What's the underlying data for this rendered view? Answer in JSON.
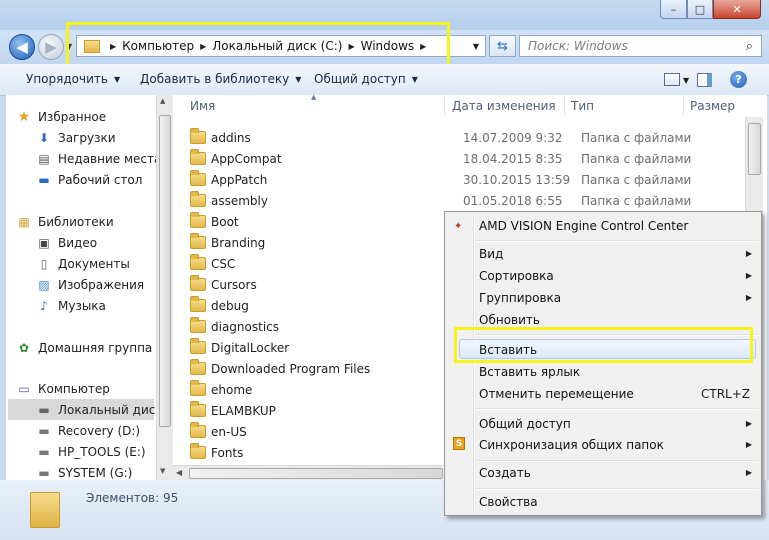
{
  "window": {
    "minimize_label": "–",
    "maximize_label": "□",
    "close_label": "✕"
  },
  "nav": {
    "back_icon": "back-arrow-icon",
    "forward_icon": "forward-arrow-icon"
  },
  "address": {
    "crumbs": [
      "Компьютер",
      "Локальный диск (C:)",
      "Windows"
    ],
    "highlight_color": "#f6f21a"
  },
  "search": {
    "placeholder": "Поиск: Windows"
  },
  "toolbar": {
    "organize": "Упорядочить",
    "add_to_library": "Добавить в библиотеку",
    "share": "Общий доступ"
  },
  "sidebar": {
    "favorites": "Избранное",
    "downloads": "Загрузки",
    "recent": "Недавние места",
    "desktop": "Рабочий стол",
    "libraries": "Библиотеки",
    "video": "Видео",
    "documents": "Документы",
    "images": "Изображения",
    "music": "Музыка",
    "homegroup": "Домашняя группа",
    "computer": "Компьютер",
    "local_disk": "Локальный диск",
    "recovery": "Recovery (D:)",
    "hp_tools": "HP_TOOLS (E:)",
    "system": "SYSTEM (G:)"
  },
  "columns": {
    "name": "Имя",
    "date": "Дата изменения",
    "type": "Тип",
    "size": "Размер"
  },
  "files": [
    {
      "name": "addins",
      "date": "14.07.2009 9:32",
      "type": "Папка с файлами"
    },
    {
      "name": "AppCompat",
      "date": "18.04.2015 8:35",
      "type": "Папка с файлами"
    },
    {
      "name": "AppPatch",
      "date": "30.10.2015 13:59",
      "type": "Папка с файлами"
    },
    {
      "name": "assembly",
      "date": "01.05.2018 6:55",
      "type": "Папка с файлами"
    },
    {
      "name": "Boot",
      "date": "",
      "type": ""
    },
    {
      "name": "Branding",
      "date": "",
      "type": ""
    },
    {
      "name": "CSC",
      "date": "",
      "type": ""
    },
    {
      "name": "Cursors",
      "date": "",
      "type": ""
    },
    {
      "name": "debug",
      "date": "",
      "type": ""
    },
    {
      "name": "diagnostics",
      "date": "",
      "type": ""
    },
    {
      "name": "DigitalLocker",
      "date": "",
      "type": ""
    },
    {
      "name": "Downloaded Program Files",
      "date": "",
      "type": ""
    },
    {
      "name": "ehome",
      "date": "",
      "type": ""
    },
    {
      "name": "ELAMBKUP",
      "date": "",
      "type": ""
    },
    {
      "name": "en-US",
      "date": "",
      "type": ""
    },
    {
      "name": "Fonts",
      "date": "",
      "type": ""
    }
  ],
  "status": {
    "items_count": "Элементов: 95"
  },
  "context_menu": {
    "amd": "AMD VISION Engine Control Center",
    "view": "Вид",
    "sort": "Сортировка",
    "group": "Группировка",
    "refresh": "Обновить",
    "paste": "Вставить",
    "paste_shortcut": "Вставить ярлык",
    "undo_move": "Отменить перемещение",
    "undo_shortcut": "CTRL+Z",
    "share": "Общий доступ",
    "sync": "Синхронизация общих папок",
    "create": "Создать",
    "properties": "Свойства"
  }
}
